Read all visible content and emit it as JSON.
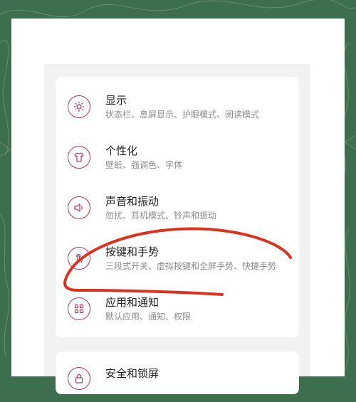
{
  "settings": {
    "items": [
      {
        "title": "显示",
        "subtitle": "状态栏、息屏显示、护眼模式、阅读模式",
        "icon": "brightness-icon"
      },
      {
        "title": "个性化",
        "subtitle": "壁纸、强调色、字体",
        "icon": "tshirt-icon"
      },
      {
        "title": "声音和振动",
        "subtitle": "勿扰、耳机模式、铃声和振动",
        "icon": "speaker-icon"
      },
      {
        "title": "按键和手势",
        "subtitle": "三段式开关、虚拟按键和全屏手势、快捷手势",
        "icon": "touch-icon"
      },
      {
        "title": "应用和通知",
        "subtitle": "默认应用、通知、权限",
        "icon": "apps-grid-icon"
      },
      {
        "title": "安全和锁屏",
        "subtitle": "",
        "icon": "lock-icon"
      }
    ]
  },
  "colors": {
    "accent": "#b23a5a",
    "background": "#3d6e4e",
    "annotation": "#d8341f"
  }
}
